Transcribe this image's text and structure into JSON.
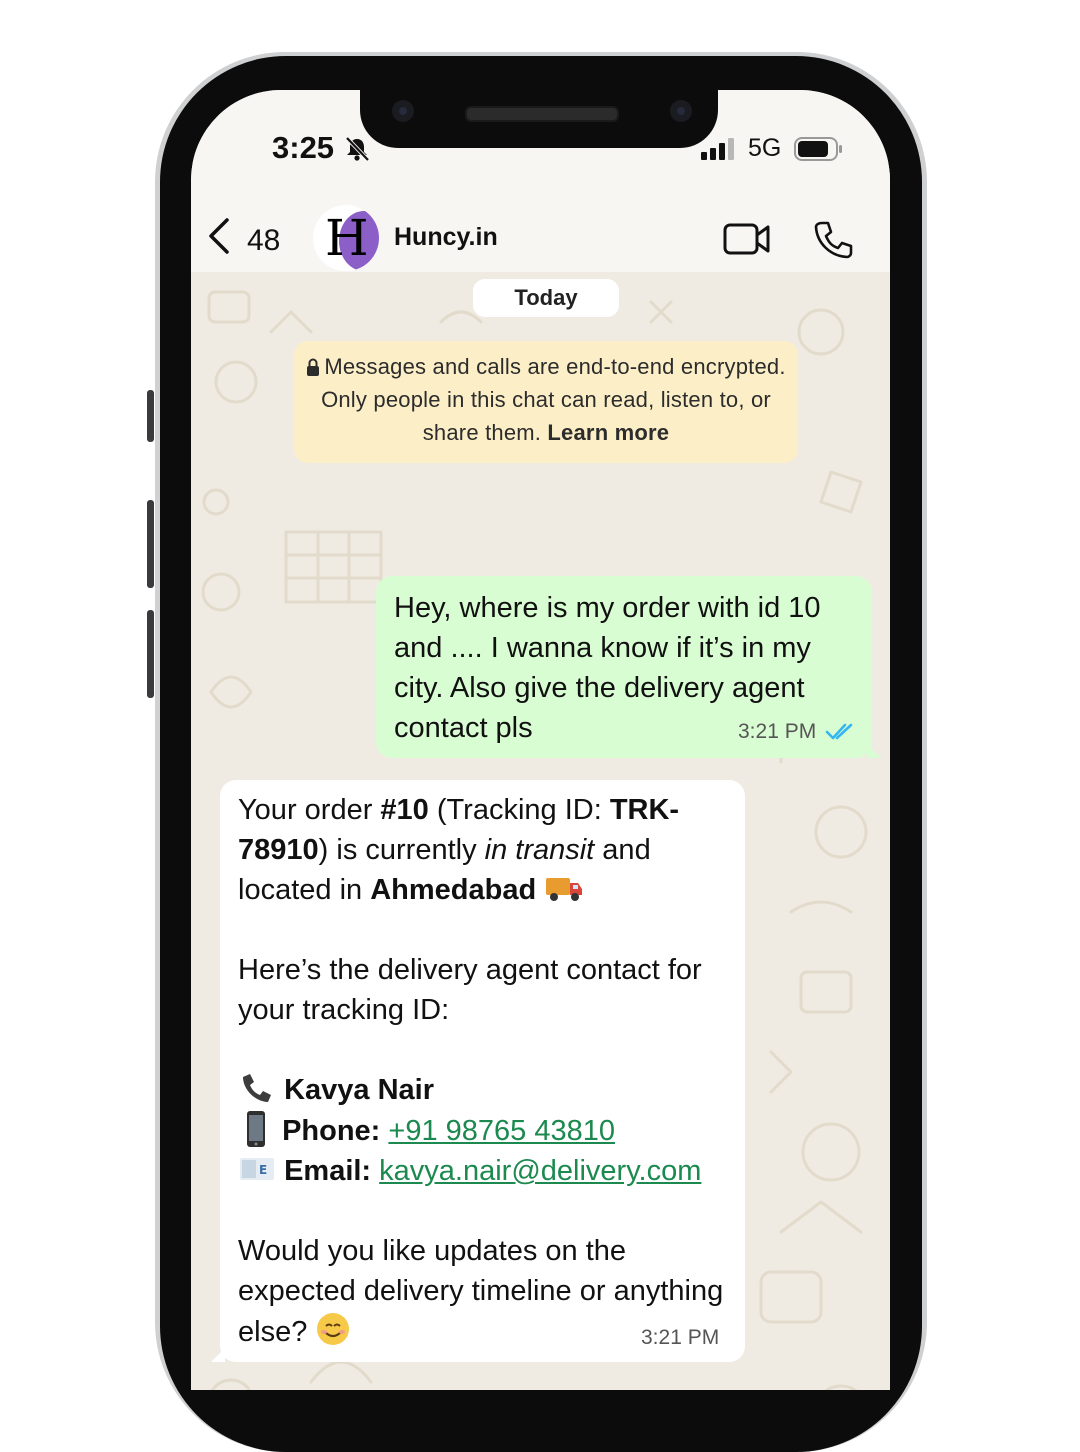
{
  "status_bar": {
    "time": "3:25",
    "network": "5G",
    "icons": [
      "bell-slash-icon",
      "signal-icon",
      "battery-icon"
    ]
  },
  "header": {
    "unread_count": "48",
    "avatar_letter": "H",
    "contact_name": "Huncy.in",
    "icons": [
      "back-chevron-icon",
      "video-call-icon",
      "voice-call-icon"
    ]
  },
  "chat": {
    "date_label": "Today",
    "encryption_notice": {
      "text": "Messages and calls are end-to-end encrypted. Only people in this chat can read, listen to, or share them.",
      "link_label": "Learn more"
    },
    "outgoing": {
      "text": "Hey, where is my order with id 10 and .... I wanna know if it’s in my city. Also give the delivery agent contact pls",
      "time": "3:21 PM",
      "status": "read"
    },
    "incoming": {
      "p1_a": "Your order ",
      "p1_order": "#10",
      "p1_b": " (Tracking ID: ",
      "p1_tracking": "TRK-78910",
      "p1_c": ") is currently ",
      "p1_status": "in transit",
      "p1_d": " and located in ",
      "p1_city": "Ahmedabad",
      "p2": "Here’s the delivery agent contact for your tracking ID:",
      "agent_name": "Kavya Nair",
      "phone_label": "Phone:",
      "phone_value": "+91 98765 43810",
      "email_label": "Email:",
      "email_value": "kavya.nair@delivery.com",
      "p3": "Would you like updates on the expected delivery timeline or anything else?",
      "time": "3:21 PM"
    }
  },
  "colors": {
    "outgoing_bubble": "#d9fdd3",
    "incoming_bubble": "#ffffff",
    "notice_bg": "#fcefc8",
    "link": "#1c8a4f",
    "read_ticks": "#34b7f1",
    "avatar_accent": "#8b5fc7"
  }
}
